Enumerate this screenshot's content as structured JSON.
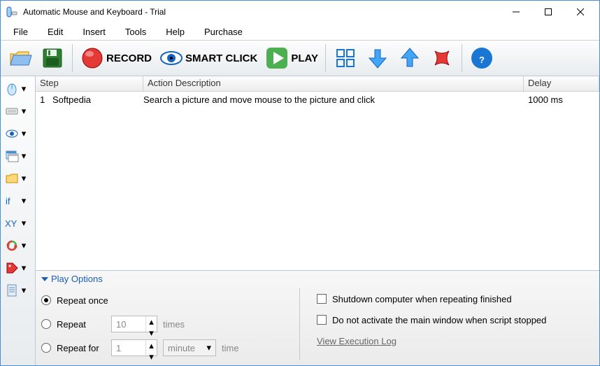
{
  "window": {
    "title": "Automatic Mouse and Keyboard - Trial"
  },
  "menu": {
    "file": "File",
    "edit": "Edit",
    "insert": "Insert",
    "tools": "Tools",
    "help": "Help",
    "purchase": "Purchase"
  },
  "toolbar": {
    "record": "RECORD",
    "smart_click": "SMART CLICK",
    "play": "PLAY"
  },
  "side_icons": {
    "mouse": "mouse-icon",
    "keyboard": "keyboard-icon",
    "eye": "eye-icon",
    "window": "window-icon",
    "folder": "folder-icon",
    "if": "if-icon",
    "xy": "xy-icon",
    "loop": "loop-icon",
    "tag": "tag-icon",
    "doc": "document-icon"
  },
  "grid": {
    "headers": {
      "step": "Step",
      "desc": "Action Description",
      "delay": "Delay"
    },
    "rows": [
      {
        "num": "1",
        "name": "Softpedia",
        "desc": "Search a picture and move mouse to the picture and click",
        "delay": "1000 ms"
      }
    ]
  },
  "play_options": {
    "title": "Play Options",
    "repeat_once": "Repeat once",
    "repeat": "Repeat",
    "repeat_n": "10",
    "times": "times",
    "repeat_for": "Repeat for",
    "repeat_for_n": "1",
    "unit": "minute",
    "time_label": "time",
    "shutdown": "Shutdown computer when repeating finished",
    "dont_activate": "Do not activate the main window when script stopped",
    "view_log": "View Execution Log"
  }
}
